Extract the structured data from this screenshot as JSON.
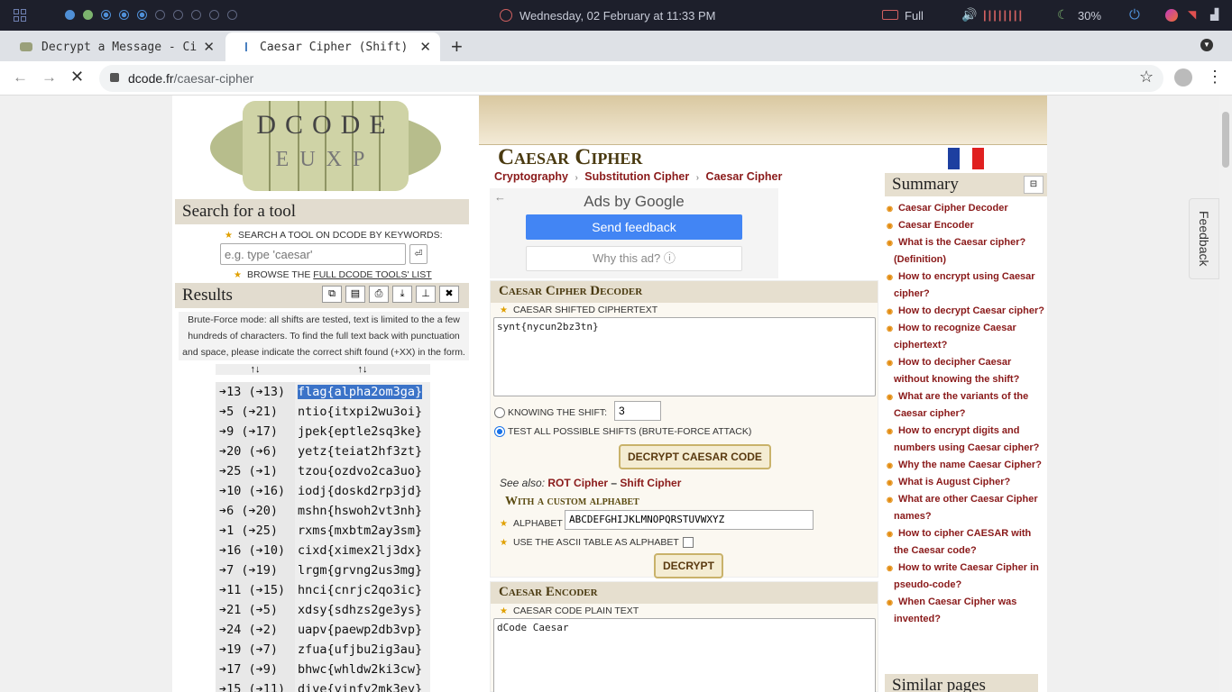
{
  "os": {
    "datetime": "Wednesday, 02 February at 11:33 PM",
    "power_mode": "Full",
    "volume_bars": "||||||||",
    "battery": "30%"
  },
  "browser": {
    "tabs": [
      {
        "title": "Decrypt a Message - Ci",
        "close": "✕"
      },
      {
        "title": "Caesar Cipher (Shift)",
        "close": "✕"
      }
    ],
    "new_tab": "+",
    "url_host": "dcode.fr",
    "url_path": "/caesar-cipher"
  },
  "left": {
    "search_heading": "Search for a tool",
    "search_label": "SEARCH A TOOL ON DCODE BY KEYWORDS:",
    "search_placeholder": "e.g. type 'caesar'",
    "browse_prefix": "BROWSE THE ",
    "browse_link": "FULL DCODE TOOLS' LIST",
    "results_heading": "Results",
    "bruteforce_note": "Brute-Force mode: all shifts are tested, text is limited to the a few hundreds of characters. To find the full text back with punctuation and space, please indicate the correct shift found (+XX) in the form.",
    "sort_col1": "↑↓",
    "sort_col2": "↑↓",
    "results": [
      {
        "shift": "➔13 (➔13)",
        "text": "flag{alpha2om3ga}"
      },
      {
        "shift": "➔5 (➔21)",
        "text": "ntio{itxpi2wu3oi}"
      },
      {
        "shift": "➔9 (➔17)",
        "text": "jpek{eptle2sq3ke}"
      },
      {
        "shift": "➔20 (➔6)",
        "text": "yetz{teiat2hf3zt}"
      },
      {
        "shift": "➔25 (➔1)",
        "text": "tzou{ozdvo2ca3uo}"
      },
      {
        "shift": "➔10 (➔16)",
        "text": "iodj{doskd2rp3jd}"
      },
      {
        "shift": "➔6 (➔20)",
        "text": "mshn{hswoh2vt3nh}"
      },
      {
        "shift": "➔1 (➔25)",
        "text": "rxms{mxbtm2ay3sm}"
      },
      {
        "shift": "➔16 (➔10)",
        "text": "cixd{ximex2lj3dx}"
      },
      {
        "shift": "➔7 (➔19)",
        "text": "lrgm{grvng2us3mg}"
      },
      {
        "shift": "➔11 (➔15)",
        "text": "hnci{cnrjc2qo3ic}"
      },
      {
        "shift": "➔21 (➔5)",
        "text": "xdsy{sdhzs2ge3ys}"
      },
      {
        "shift": "➔24 (➔2)",
        "text": "uapv{paewp2db3vp}"
      },
      {
        "shift": "➔19 (➔7)",
        "text": "zfua{ufjbu2ig3au}"
      },
      {
        "shift": "➔17 (➔9)",
        "text": "bhwc{whldw2ki3cw}"
      },
      {
        "shift": "➔15 (➔11)",
        "text": "dive{yinfy2mk3ey}"
      }
    ]
  },
  "main": {
    "title": "Caesar Cipher",
    "breadcrumbs": [
      "Cryptography",
      "Substitution Cipher",
      "Caesar Cipher"
    ],
    "ad_label": "Ads by Google",
    "ad_feedback": "Send feedback",
    "ad_why": "Why this ad? ⓘ",
    "decoder_heading": "Caesar Cipher Decoder",
    "cipher_label": "CAESAR SHIFTED CIPHERTEXT",
    "cipher_value": "synt{nycun2bz3tn}",
    "knowing_shift_label": "KNOWING THE SHIFT:",
    "shift_value": "3",
    "bruteforce_label": "TEST ALL POSSIBLE SHIFTS (BRUTE-FORCE ATTACK)",
    "decrypt_btn": "DECRYPT CAESAR CODE",
    "see_also": "See also:",
    "see_rot": "ROT Cipher",
    "see_dash": " – ",
    "see_shift": "Shift Cipher",
    "custom_alpha_heading": "With a custom alphabet",
    "alphabet_label": "ALPHABET",
    "alphabet_value": "ABCDEFGHIJKLMNOPQRSTUVWXYZ",
    "ascii_label": "USE THE ASCII TABLE AS ALPHABET",
    "decrypt2_btn": "DECRYPT",
    "encoder_heading": "Caesar Encoder",
    "plain_label": "CAESAR CODE PLAIN TEXT",
    "plain_value": "dCode Caesar"
  },
  "summary": {
    "heading": "Summary",
    "collapse": "⊟",
    "items": [
      "Caesar Cipher Decoder",
      "Caesar Encoder",
      "What is the Caesar cipher? (Definition)",
      "How to encrypt using Caesar cipher?",
      "How to decrypt Caesar cipher?",
      "How to recognize Caesar ciphertext?",
      "How to decipher Caesar without knowing the shift?",
      "What are the variants of the Caesar cipher?",
      "How to encrypt digits and numbers using Caesar cipher?",
      "Why the name Caesar Cipher?",
      "What is August Cipher?",
      "What are other Caesar Cipher names?",
      "How to cipher CAESAR with the Caesar code?",
      "How to write Caesar Cipher in pseudo-code?",
      "When Caesar Cipher was invented?"
    ],
    "similar_heading": "Similar pages"
  },
  "feedback_tab": "Feedback",
  "logo_text": "DCODE"
}
